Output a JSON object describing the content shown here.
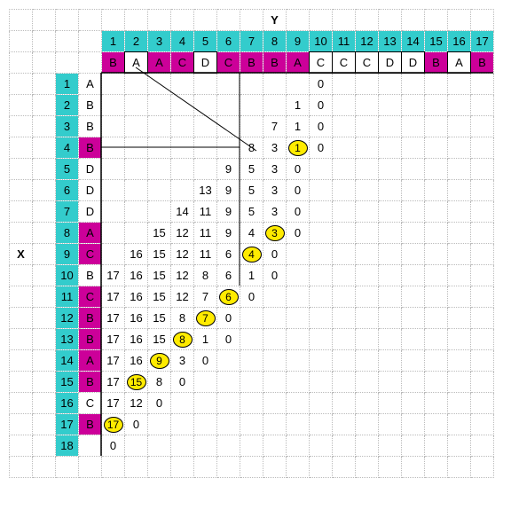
{
  "axis": {
    "x_label": "X",
    "y_label": "Y"
  },
  "y_header_nums": [
    "1",
    "2",
    "3",
    "4",
    "5",
    "6",
    "7",
    "8",
    "9",
    "10",
    "11",
    "12",
    "13",
    "14",
    "15",
    "16",
    "17"
  ],
  "y_header_letters": [
    {
      "v": "B",
      "hl": true
    },
    {
      "v": "A",
      "hl": false
    },
    {
      "v": "A",
      "hl": true
    },
    {
      "v": "C",
      "hl": true
    },
    {
      "v": "D",
      "hl": false
    },
    {
      "v": "C",
      "hl": true
    },
    {
      "v": "B",
      "hl": true
    },
    {
      "v": "B",
      "hl": true
    },
    {
      "v": "A",
      "hl": true
    },
    {
      "v": "C",
      "hl": false
    },
    {
      "v": "C",
      "hl": false
    },
    {
      "v": "C",
      "hl": false
    },
    {
      "v": "D",
      "hl": false
    },
    {
      "v": "D",
      "hl": false
    },
    {
      "v": "B",
      "hl": true
    },
    {
      "v": "A",
      "hl": false
    },
    {
      "v": "B",
      "hl": true
    }
  ],
  "x_header": [
    {
      "n": "1",
      "v": "A",
      "hl": false
    },
    {
      "n": "2",
      "v": "B",
      "hl": false
    },
    {
      "n": "3",
      "v": "B",
      "hl": false
    },
    {
      "n": "4",
      "v": "B",
      "hl": true
    },
    {
      "n": "5",
      "v": "D",
      "hl": false
    },
    {
      "n": "6",
      "v": "D",
      "hl": false
    },
    {
      "n": "7",
      "v": "D",
      "hl": false
    },
    {
      "n": "8",
      "v": "A",
      "hl": true
    },
    {
      "n": "9",
      "v": "C",
      "hl": true
    },
    {
      "n": "10",
      "v": "B",
      "hl": false
    },
    {
      "n": "11",
      "v": "C",
      "hl": true
    },
    {
      "n": "12",
      "v": "B",
      "hl": true
    },
    {
      "n": "13",
      "v": "B",
      "hl": true
    },
    {
      "n": "14",
      "v": "A",
      "hl": true
    },
    {
      "n": "15",
      "v": "B",
      "hl": true
    },
    {
      "n": "16",
      "v": "C",
      "hl": false
    },
    {
      "n": "17",
      "v": "B",
      "hl": true
    },
    {
      "n": "18",
      "v": "",
      "hl": false
    }
  ],
  "chart_data": {
    "type": "table",
    "title": "Dynamic programming alignment matrix diagonal with traceback",
    "xlabel": "X",
    "ylabel": "Y",
    "y_sequence": [
      "B",
      "A",
      "A",
      "C",
      "D",
      "C",
      "B",
      "B",
      "A",
      "C",
      "C",
      "C",
      "D",
      "D",
      "B",
      "A",
      "B"
    ],
    "x_sequence": [
      "A",
      "B",
      "B",
      "B",
      "D",
      "D",
      "D",
      "A",
      "C",
      "B",
      "C",
      "B",
      "B",
      "A",
      "B",
      "C",
      "B"
    ],
    "rows": [
      {
        "i": 1,
        "cells": [
          {
            "c": 10,
            "v": 0
          }
        ]
      },
      {
        "i": 2,
        "cells": [
          {
            "c": 9,
            "v": 1
          },
          {
            "c": 10,
            "v": 0
          }
        ]
      },
      {
        "i": 3,
        "cells": [
          {
            "c": 8,
            "v": 7
          },
          {
            "c": 9,
            "v": 1
          },
          {
            "c": 10,
            "v": 0
          }
        ]
      },
      {
        "i": 4,
        "cells": [
          {
            "c": 7,
            "v": 8
          },
          {
            "c": 8,
            "v": 3
          },
          {
            "c": 9,
            "v": 1,
            "circ": true
          },
          {
            "c": 10,
            "v": 0
          }
        ]
      },
      {
        "i": 5,
        "cells": [
          {
            "c": 6,
            "v": 9
          },
          {
            "c": 7,
            "v": 5
          },
          {
            "c": 8,
            "v": 3
          },
          {
            "c": 9,
            "v": 0
          }
        ]
      },
      {
        "i": 6,
        "cells": [
          {
            "c": 5,
            "v": 13
          },
          {
            "c": 6,
            "v": 9
          },
          {
            "c": 7,
            "v": 5
          },
          {
            "c": 8,
            "v": 3
          },
          {
            "c": 9,
            "v": 0
          }
        ]
      },
      {
        "i": 7,
        "cells": [
          {
            "c": 4,
            "v": 14
          },
          {
            "c": 5,
            "v": 11
          },
          {
            "c": 6,
            "v": 9
          },
          {
            "c": 7,
            "v": 5
          },
          {
            "c": 8,
            "v": 3
          },
          {
            "c": 9,
            "v": 0
          }
        ]
      },
      {
        "i": 8,
        "cells": [
          {
            "c": 3,
            "v": 15
          },
          {
            "c": 4,
            "v": 12
          },
          {
            "c": 5,
            "v": 11
          },
          {
            "c": 6,
            "v": 9
          },
          {
            "c": 7,
            "v": 4
          },
          {
            "c": 8,
            "v": 3,
            "circ": true
          },
          {
            "c": 9,
            "v": 0
          }
        ]
      },
      {
        "i": 9,
        "cells": [
          {
            "c": 2,
            "v": 16
          },
          {
            "c": 3,
            "v": 15
          },
          {
            "c": 4,
            "v": 12
          },
          {
            "c": 5,
            "v": 11
          },
          {
            "c": 6,
            "v": 6
          },
          {
            "c": 7,
            "v": 4,
            "circ": true
          },
          {
            "c": 8,
            "v": 0
          }
        ]
      },
      {
        "i": 10,
        "cells": [
          {
            "c": 1,
            "v": 17
          },
          {
            "c": 2,
            "v": 16
          },
          {
            "c": 3,
            "v": 15
          },
          {
            "c": 4,
            "v": 12
          },
          {
            "c": 5,
            "v": 8
          },
          {
            "c": 6,
            "v": 6
          },
          {
            "c": 7,
            "v": 1
          },
          {
            "c": 8,
            "v": 0
          }
        ]
      },
      {
        "i": 11,
        "cells": [
          {
            "c": 1,
            "v": 17
          },
          {
            "c": 2,
            "v": 16
          },
          {
            "c": 3,
            "v": 15
          },
          {
            "c": 4,
            "v": 12
          },
          {
            "c": 5,
            "v": 7
          },
          {
            "c": 6,
            "v": 6,
            "circ": true
          },
          {
            "c": 7,
            "v": 0
          }
        ]
      },
      {
        "i": 12,
        "cells": [
          {
            "c": 1,
            "v": 17
          },
          {
            "c": 2,
            "v": 16
          },
          {
            "c": 3,
            "v": 15
          },
          {
            "c": 4,
            "v": 8
          },
          {
            "c": 5,
            "v": 7,
            "circ": true
          },
          {
            "c": 6,
            "v": 0
          }
        ]
      },
      {
        "i": 13,
        "cells": [
          {
            "c": 1,
            "v": 17
          },
          {
            "c": 2,
            "v": 16
          },
          {
            "c": 3,
            "v": 15
          },
          {
            "c": 4,
            "v": 8,
            "circ": true
          },
          {
            "c": 5,
            "v": 1
          },
          {
            "c": 6,
            "v": 0
          }
        ]
      },
      {
        "i": 14,
        "cells": [
          {
            "c": 1,
            "v": 17
          },
          {
            "c": 2,
            "v": 16
          },
          {
            "c": 3,
            "v": 9,
            "circ": true
          },
          {
            "c": 4,
            "v": 3
          },
          {
            "c": 5,
            "v": 0
          }
        ]
      },
      {
        "i": 15,
        "cells": [
          {
            "c": 1,
            "v": 17
          },
          {
            "c": 2,
            "v": 15,
            "circ": true
          },
          {
            "c": 3,
            "v": 8
          },
          {
            "c": 4,
            "v": 0
          }
        ]
      },
      {
        "i": 16,
        "cells": [
          {
            "c": 1,
            "v": 17
          },
          {
            "c": 2,
            "v": 12
          },
          {
            "c": 3,
            "v": 0
          }
        ]
      },
      {
        "i": 17,
        "cells": [
          {
            "c": 1,
            "v": 17,
            "circ": true
          },
          {
            "c": 2,
            "v": 0
          }
        ]
      },
      {
        "i": 18,
        "cells": [
          {
            "c": 1,
            "v": 0
          }
        ]
      }
    ]
  }
}
